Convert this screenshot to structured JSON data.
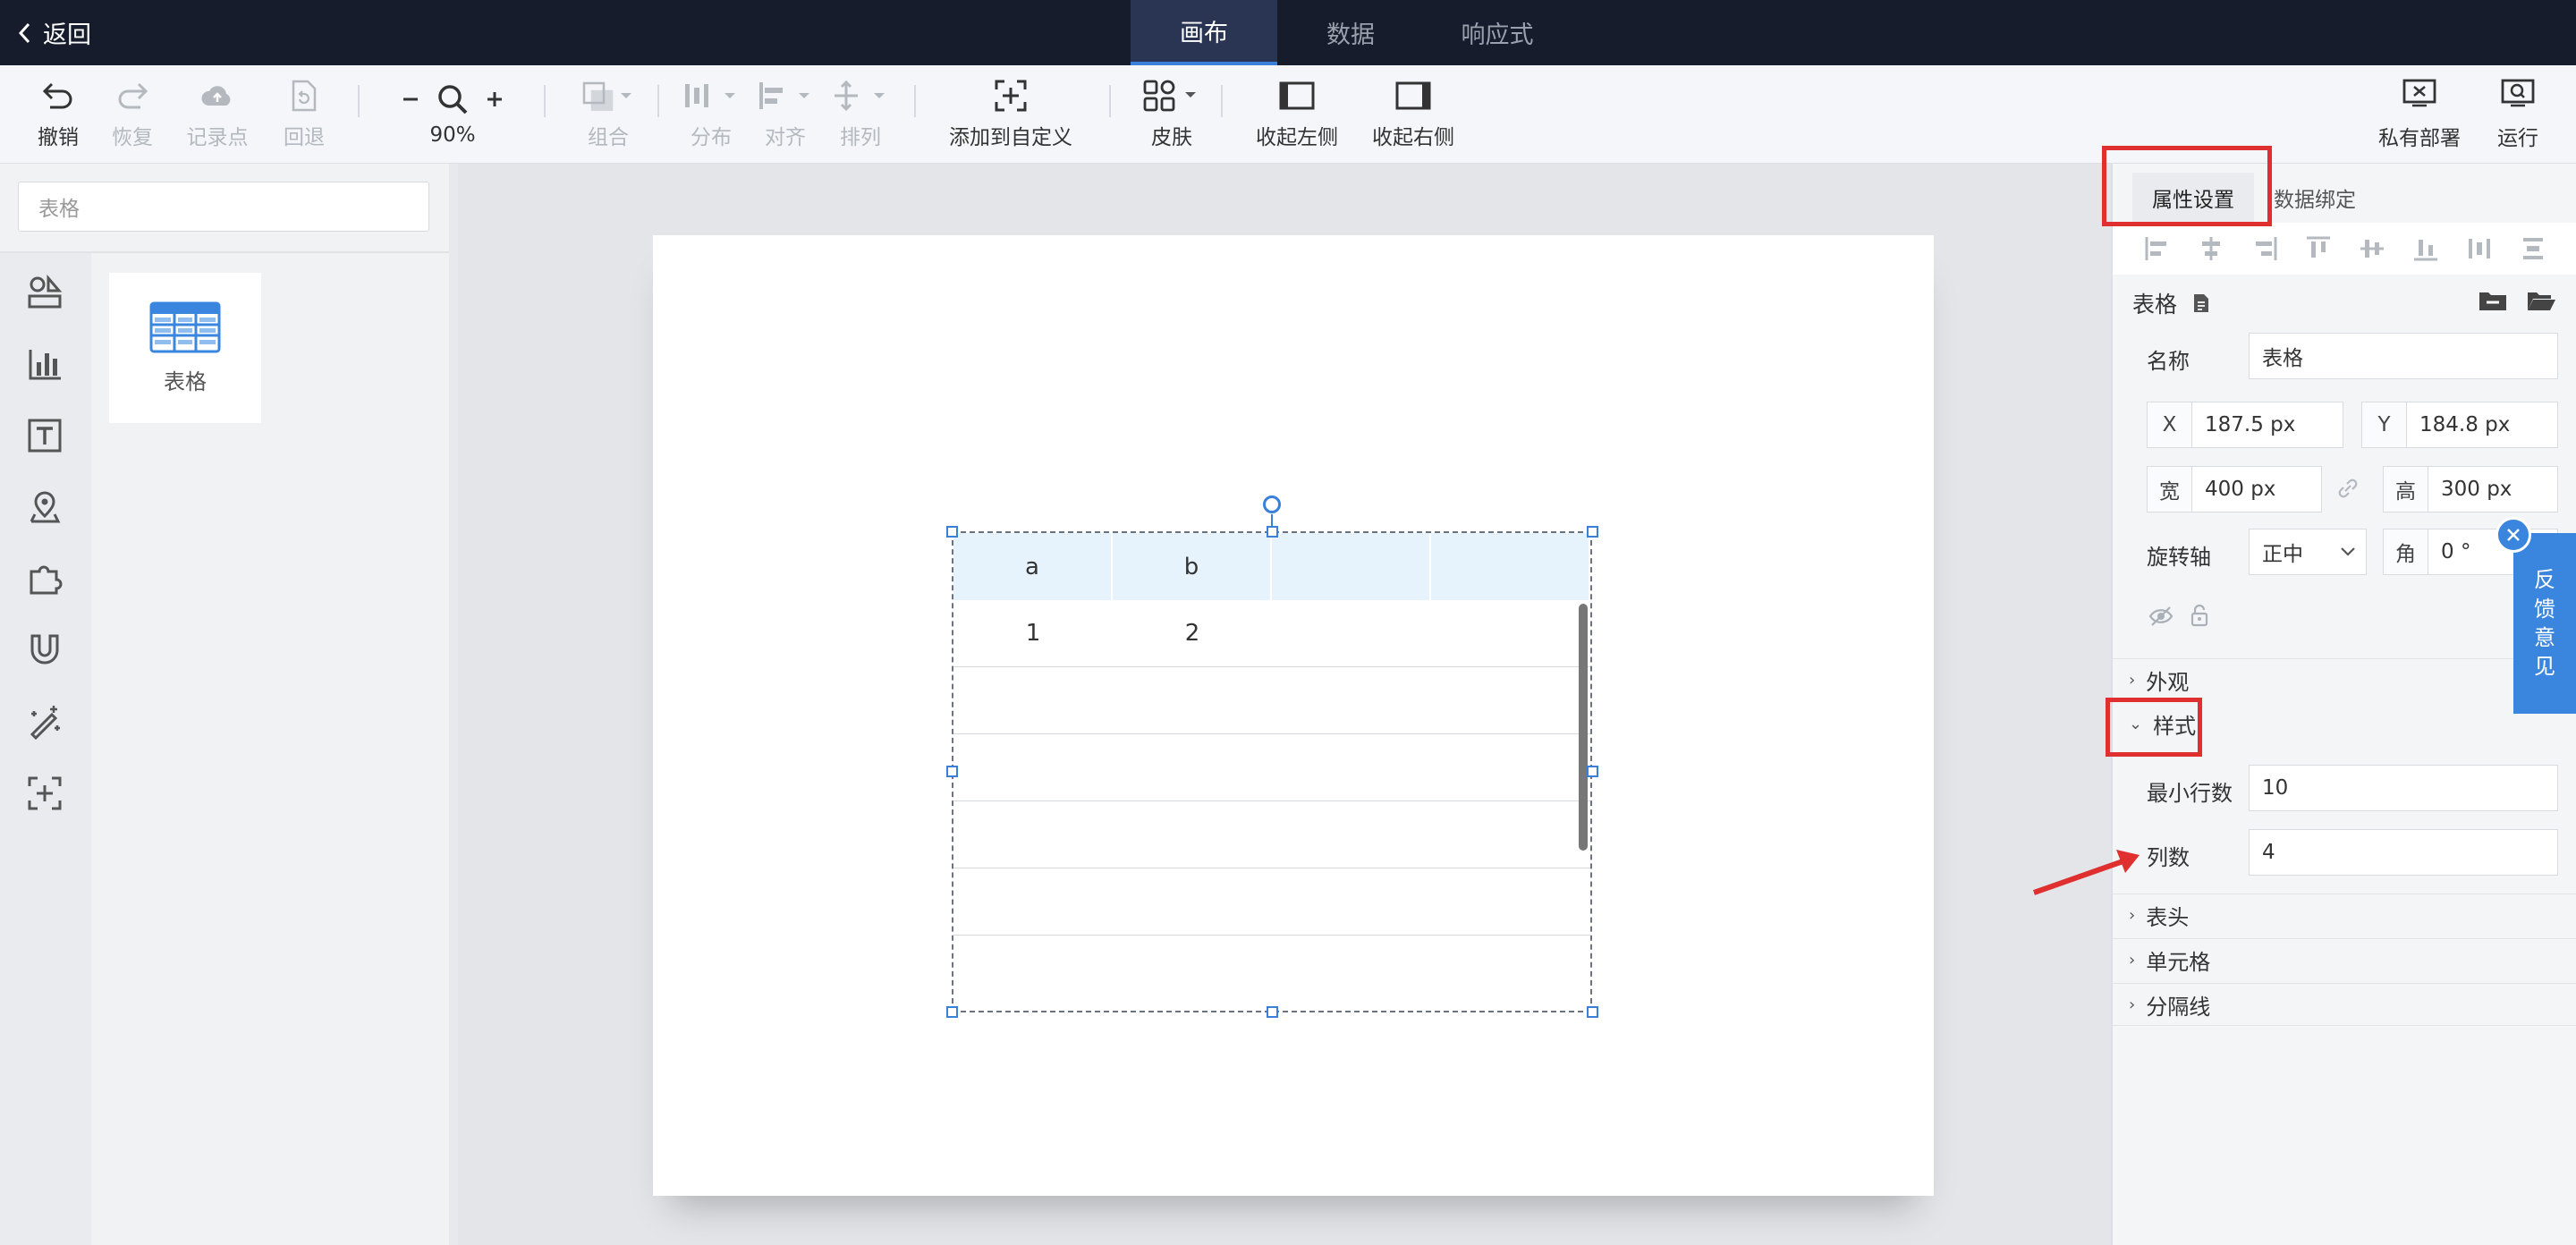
{
  "nav": {
    "back_label": "返回",
    "tabs": [
      {
        "label": "画布",
        "active": true
      },
      {
        "label": "数据",
        "active": false
      },
      {
        "label": "响应式",
        "active": false
      }
    ]
  },
  "toolbar": {
    "undo": "撤销",
    "redo": "恢复",
    "checkpoint": "记录点",
    "rollback": "回退",
    "zoom": "90%",
    "group": "组合",
    "distribute": "分布",
    "align": "对齐",
    "arrange": "排列",
    "add_custom": "添加到自定义",
    "skin": "皮肤",
    "collapse_left": "收起左侧",
    "collapse_right": "收起右侧",
    "private_deploy": "私有部署",
    "run": "运行"
  },
  "left": {
    "search_placeholder": "表格",
    "component_label": "表格"
  },
  "canvas": {
    "table": {
      "header": [
        "a",
        "b",
        "",
        ""
      ],
      "rows": [
        [
          "1",
          "2",
          "",
          ""
        ],
        [
          "",
          "",
          "",
          ""
        ],
        [
          "",
          "",
          "",
          ""
        ],
        [
          "",
          "",
          "",
          ""
        ],
        [
          "",
          "",
          "",
          ""
        ]
      ]
    }
  },
  "right": {
    "tab_properties": "属性设置",
    "tab_binding": "数据绑定",
    "component_title": "表格",
    "name_label": "名称",
    "name_value": "表格",
    "x_label": "X",
    "x_value": "187.5 px",
    "y_label": "Y",
    "y_value": "184.8 px",
    "w_label": "宽",
    "w_value": "400 px",
    "h_label": "高",
    "h_value": "300 px",
    "rotate_axis_label": "旋转轴",
    "rotate_axis_value": "正中",
    "angle_label": "角",
    "angle_value": "0 °",
    "sections": {
      "appearance": "外观",
      "style": "样式",
      "header": "表头",
      "cell": "单元格",
      "divider": "分隔线"
    },
    "min_rows_label": "最小行数",
    "min_rows_value": "10",
    "columns_label": "列数",
    "columns_value": "4"
  },
  "feedback": [
    "反",
    "馈",
    "意",
    "见"
  ],
  "colors": {
    "topbar": "#171c2c",
    "accent": "#3a7fd8",
    "annotation": "#e02f2f",
    "table_header": "#e7f3fc"
  }
}
